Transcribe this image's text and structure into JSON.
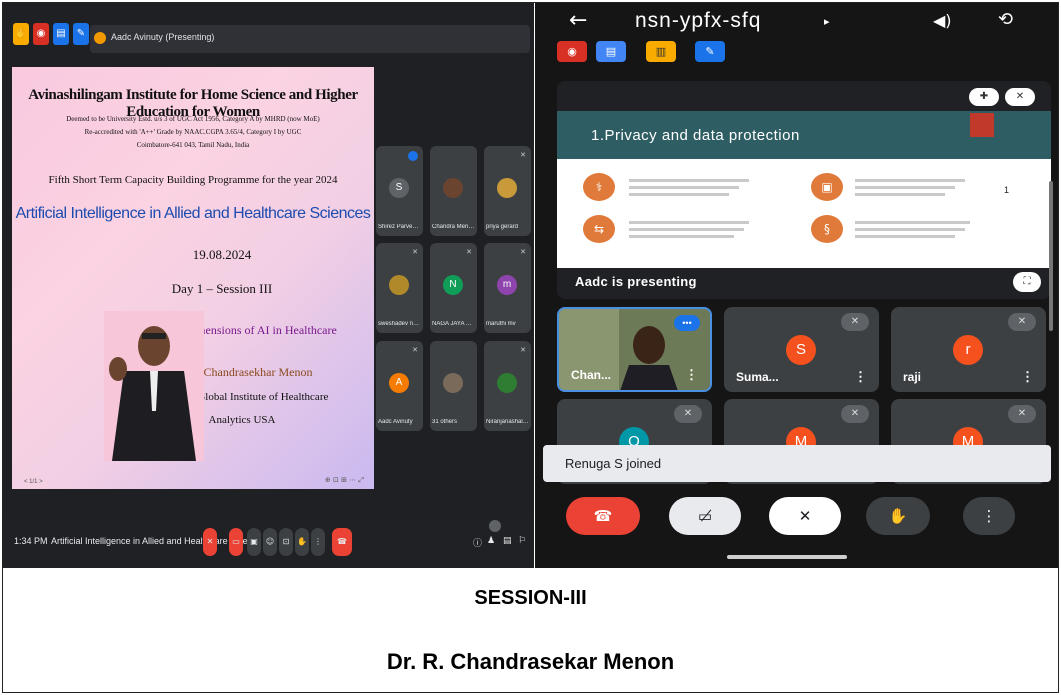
{
  "desktop_meet": {
    "presenting_label": "Aadc Avinuty (Presenting)",
    "slide": {
      "institution": "Avinashilingam Institute for Home Science and Higher Education for Women",
      "line1": "Deemed to be University Estd. u/s 3 of UGC Act 1956, Category A by MHRD (now MoE)",
      "line2": "Re-accredited with 'A++' Grade by NAAC.CGPA 3.65/4, Category I by UGC",
      "line3": "Coimbatore-641 043, Tamil Nadu, India",
      "programme": "Fifth Short Term Capacity Building Programme for the year 2024",
      "title": "Artificial Intelligence in Allied and Healthcare Sciences",
      "date": "19.08.2024",
      "day": "Day 1 – Session III",
      "topic": "Ethical Dimensions of AI in Healthcare",
      "speaker": "Dr. R. Chandrasekhar Menon",
      "director_line1": "Director, Global Institute of Healthcare",
      "director_line2": "Analytics USA"
    },
    "participants": [
      {
        "name": "Shirez Parveen ...",
        "initial": "S",
        "color": "#5f6368"
      },
      {
        "name": "Chandra Menon",
        "initial": "",
        "color": "#3c4043"
      },
      {
        "name": "priya gerard",
        "initial": "",
        "color": "#3c4043"
      },
      {
        "name": "sweshadev ney...",
        "initial": "",
        "color": "#3c4043"
      },
      {
        "name": "NAGA JAYA SRI...",
        "initial": "N",
        "color": "#0f9d58"
      },
      {
        "name": "maruthi mv",
        "initial": "m",
        "color": "#8e44ad"
      },
      {
        "name": "Aadc Avinuty",
        "initial": "A",
        "color": "#f57c00"
      },
      {
        "name": "31 others",
        "initial": "",
        "color": "#3c4043"
      },
      {
        "name": "Niranjanashale...",
        "initial": "",
        "color": "#3c4043"
      }
    ],
    "bottom": {
      "time": "1:34 PM",
      "meeting_title": "Artificial Intelligence in Allied and Healthcare Scien..."
    },
    "slide_counter": "< 1/1 >"
  },
  "mobile_meet": {
    "meeting_code": "nsn-ypfx-sfq",
    "presentation_title": "1.Privacy and data protection",
    "presentation_page": "1",
    "presenting_label": "Aadc is presenting",
    "tiles": [
      {
        "name": "Chan...",
        "initial": "",
        "color": "#5a6b4a"
      },
      {
        "name": "Suma...",
        "initial": "S",
        "color": "#f4511e"
      },
      {
        "name": "raji",
        "initial": "r",
        "color": "#f4511e"
      },
      {
        "name": "",
        "initial": "O",
        "color": "#0097a7"
      },
      {
        "name": "",
        "initial": "M",
        "color": "#f4511e"
      },
      {
        "name": "",
        "initial": "M",
        "color": "#f4511e"
      }
    ],
    "toast": "Renuga S joined"
  },
  "captions": {
    "session": "SESSION-III",
    "speaker": "Dr. R. Chandrasekar Menon"
  },
  "icons": [
    "hand-icon",
    "record-icon",
    "whiteboard-icon",
    "pen-icon",
    "back-arrow-icon",
    "speaker-icon",
    "camera-flip-icon",
    "pin-icon",
    "mic-off-icon",
    "fullscreen-icon",
    "end-call-icon",
    "camera-off-icon",
    "raise-hand-icon",
    "more-icon"
  ],
  "colors": {
    "end_call": "#ea4335",
    "slide_title_blue": "#1c4bb0",
    "presentation_header": "#2e5e63",
    "presentation_icon": "#e07a3a"
  }
}
